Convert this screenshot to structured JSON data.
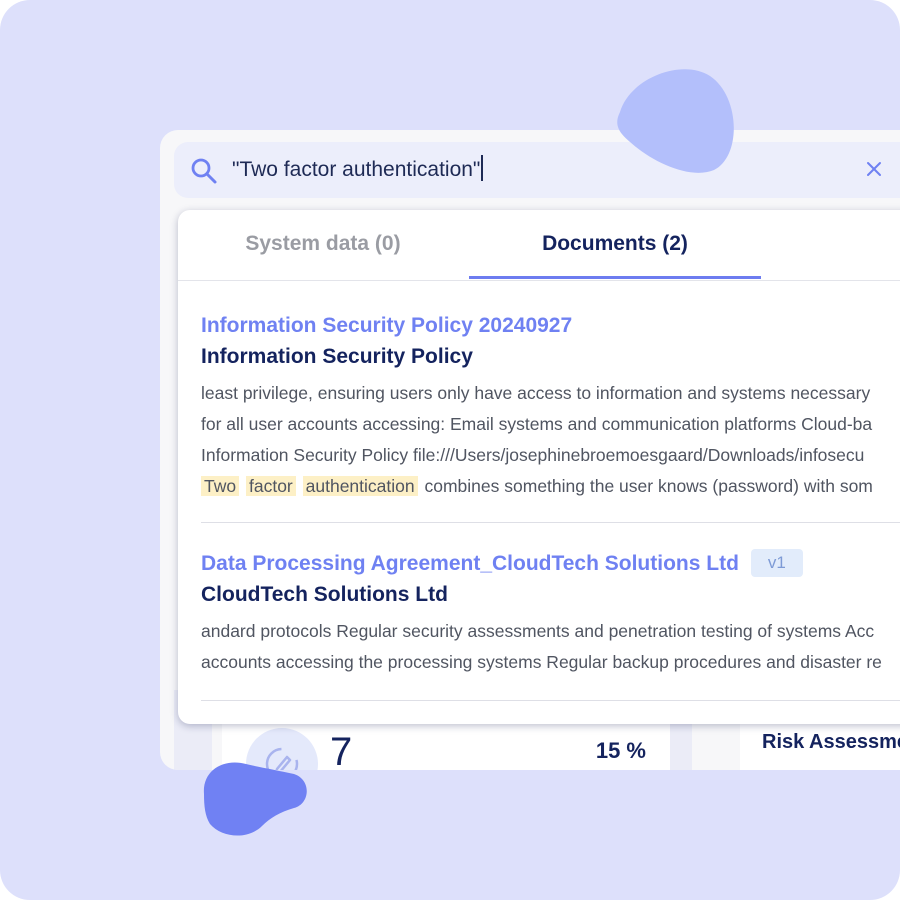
{
  "colors": {
    "background": "#dde0fb",
    "accent": "#6f81f2",
    "navy": "#14235e",
    "highlight": "#fdf0c6",
    "blob_light": "#b3bffb",
    "blob_dark": "#7081f3"
  },
  "search": {
    "value": "\"Two factor authentication\"",
    "icon": "search-icon",
    "clear_icon": "close-icon"
  },
  "tabs": [
    {
      "label": "System data (0)",
      "active": false
    },
    {
      "label": "Documents (2)",
      "active": true
    }
  ],
  "results": [
    {
      "link": "Information Security Policy 20240927",
      "title": "Information Security Policy",
      "snippet_lines": [
        "least privilege, ensuring users only have access to information and systems necessary",
        "for all user accounts accessing: Email systems and communication platforms Cloud-ba",
        "Information Security Policy file:///Users/josephinebroemoesgaard/Downloads/infosecu"
      ],
      "highlights": [
        "Two",
        "factor",
        "authentication"
      ],
      "snippet_tail": "combines something the user knows (password) with som"
    },
    {
      "link": "Data Processing Agreement_CloudTech Solutions Ltd",
      "badge": "v1",
      "title": "CloudTech Solutions Ltd",
      "snippet_lines": [
        "andard protocols Regular security assessments and penetration testing of systems Acc",
        "accounts accessing the processing systems Regular backup procedures and disaster re"
      ]
    }
  ],
  "background_dashboard": {
    "metric_count": "7",
    "metric_percent": "15 %",
    "risk_title": "Risk Assessme",
    "metric_icon": "edit-cycle-icon"
  }
}
